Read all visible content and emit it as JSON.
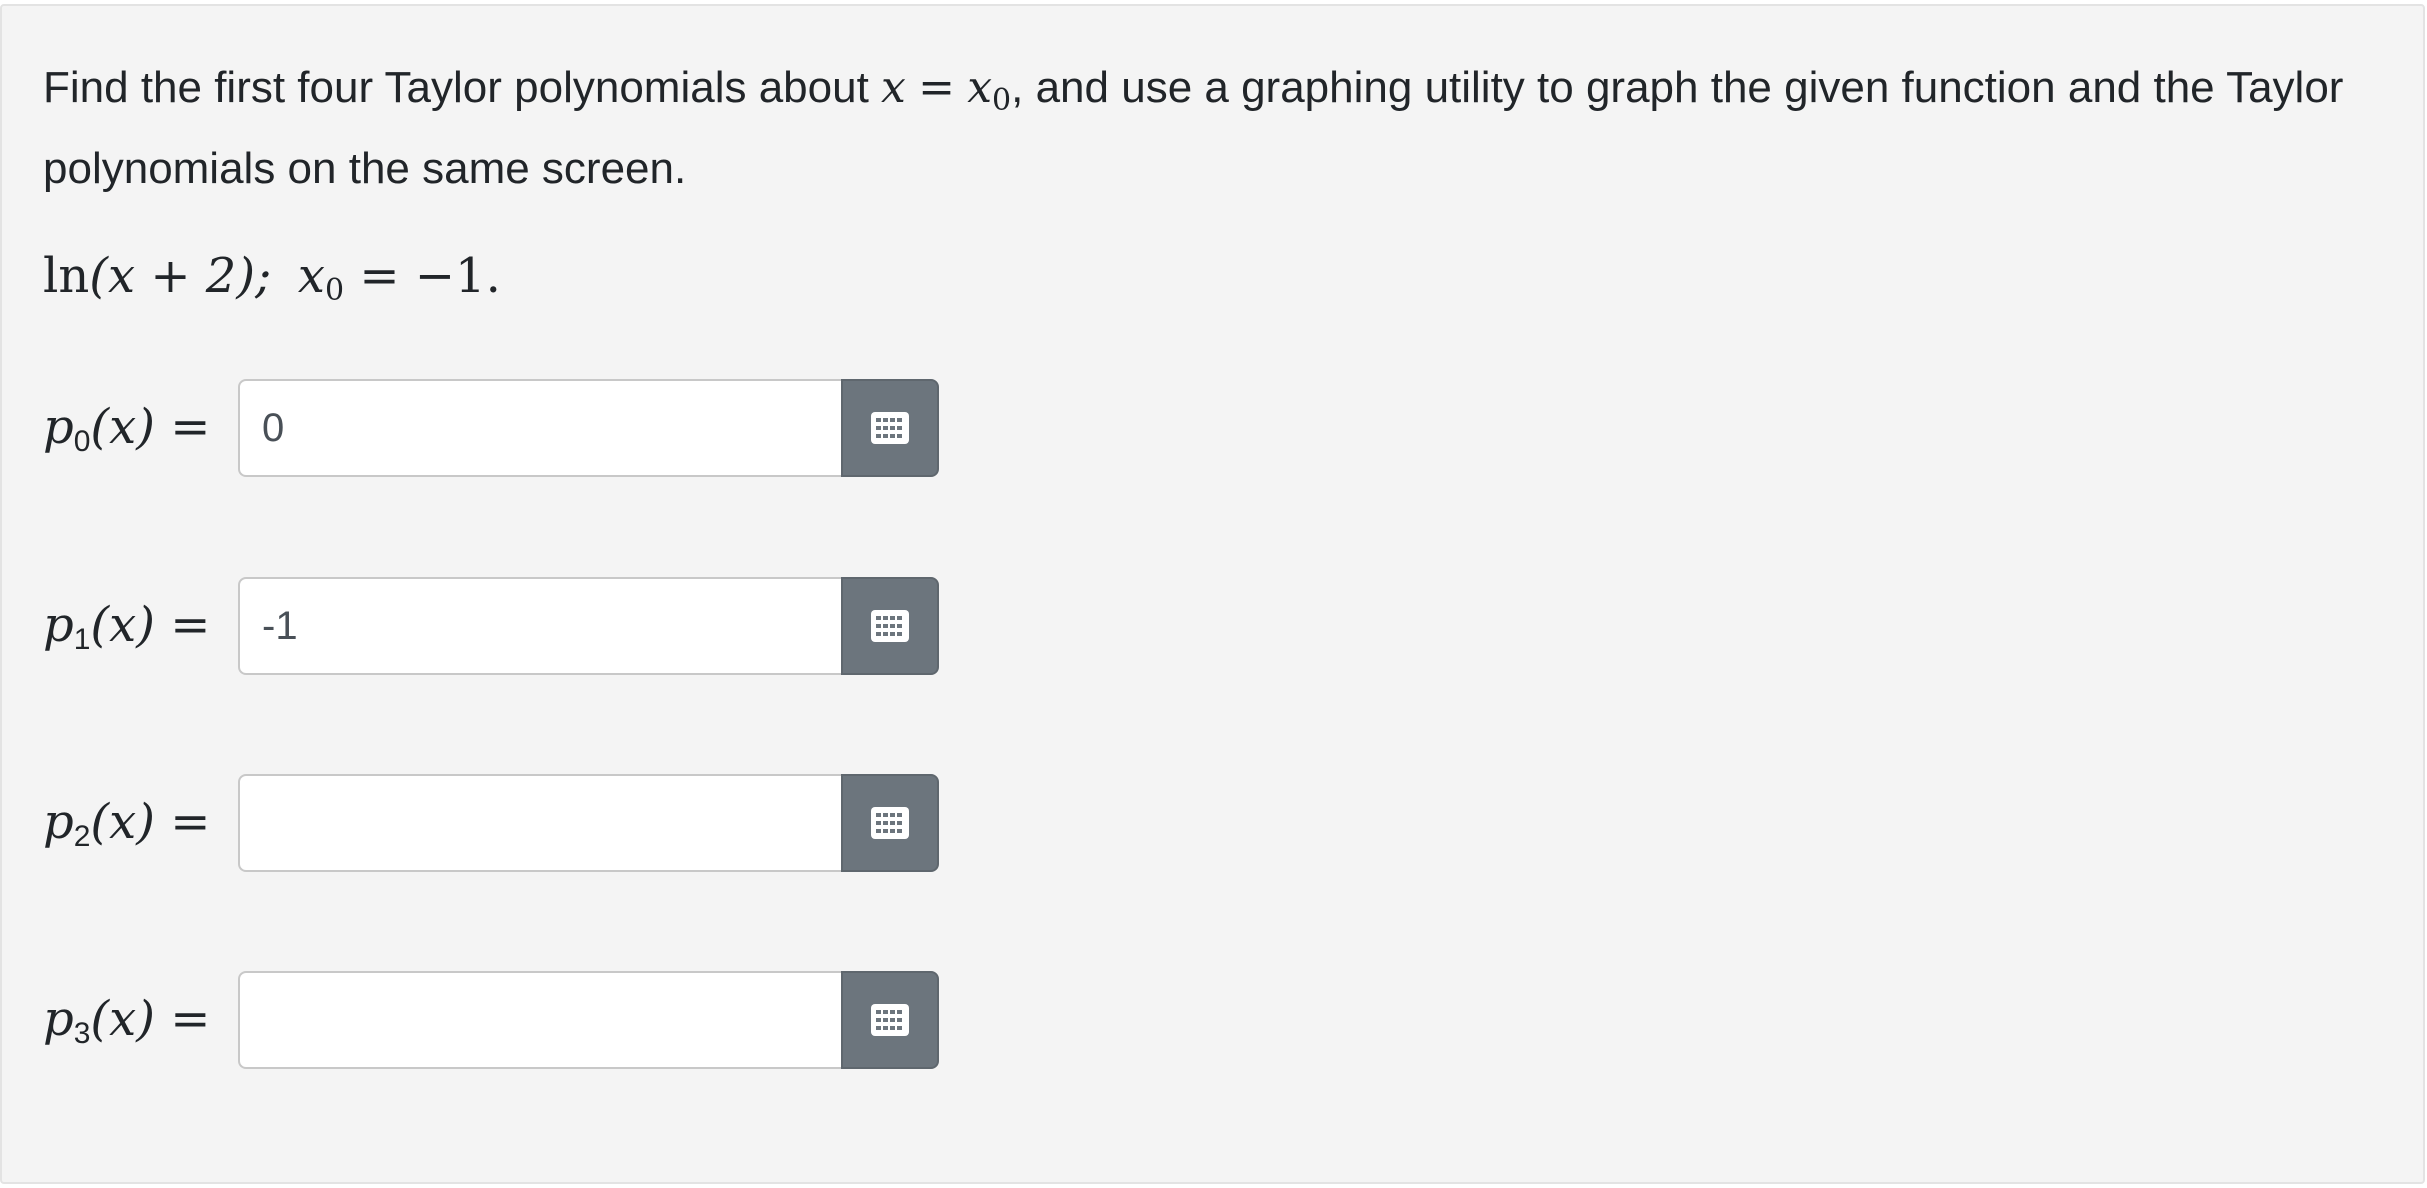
{
  "prompt": {
    "part1": "Find the first four Taylor polynomials about ",
    "var_x": "x",
    "equals": "=",
    "x0_base": "x",
    "x0_sub": "0",
    "part2": ", and use a graphing utility to graph the given function and the Taylor polynomials on the same screen."
  },
  "function_line": {
    "fn": "ln",
    "arg": "(x + 2);",
    "x0_base": "x",
    "x0_sub": "0",
    "value": " = −1."
  },
  "answers": [
    {
      "p": "p",
      "index": "0",
      "arg": "(x) =",
      "value": "0",
      "placeholder": ""
    },
    {
      "p": "p",
      "index": "1",
      "arg": "(x) =",
      "value": "-1",
      "placeholder": ""
    },
    {
      "p": "p",
      "index": "2",
      "arg": "(x) =",
      "value": "",
      "placeholder": ""
    },
    {
      "p": "p",
      "index": "3",
      "arg": "(x) =",
      "value": "",
      "placeholder": ""
    }
  ],
  "icons": {
    "keypad": "keypad-grid-icon"
  },
  "colors": {
    "panel_bg": "#f4f4f4",
    "keypad_bg": "#6c757d",
    "text": "#212529"
  }
}
